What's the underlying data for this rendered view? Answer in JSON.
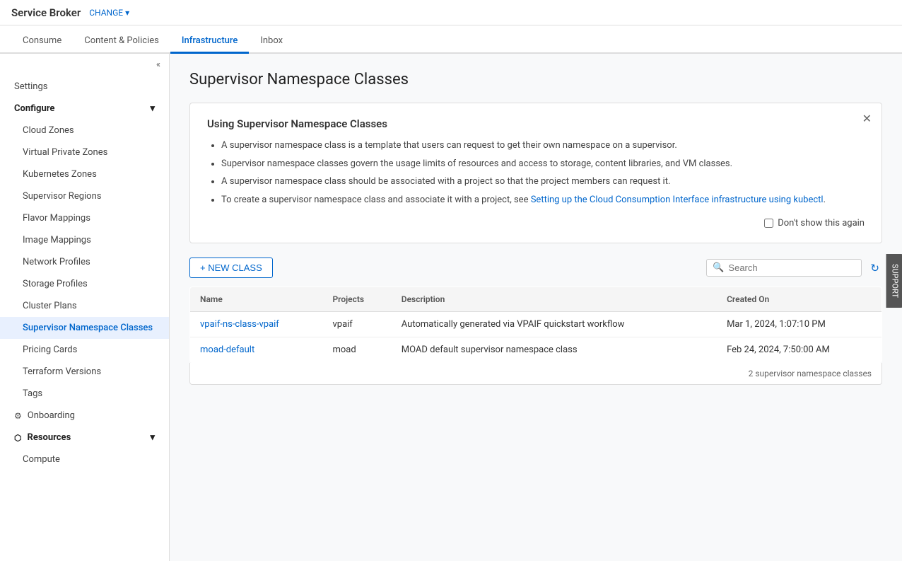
{
  "header": {
    "app_title": "Service Broker",
    "change_label": "CHANGE",
    "chevron": "▾"
  },
  "nav": {
    "tabs": [
      {
        "label": "Consume",
        "active": false
      },
      {
        "label": "Content & Policies",
        "active": false
      },
      {
        "label": "Infrastructure",
        "active": true
      },
      {
        "label": "Inbox",
        "active": false
      }
    ]
  },
  "sidebar": {
    "collapse_icon": "«",
    "items": [
      {
        "label": "Settings",
        "indent": false,
        "active": false,
        "section": false
      },
      {
        "label": "Configure",
        "indent": false,
        "active": false,
        "section": true
      },
      {
        "label": "Cloud Zones",
        "indent": true,
        "active": false,
        "section": false
      },
      {
        "label": "Virtual Private Zones",
        "indent": true,
        "active": false,
        "section": false
      },
      {
        "label": "Kubernetes Zones",
        "indent": true,
        "active": false,
        "section": false
      },
      {
        "label": "Supervisor Regions",
        "indent": true,
        "active": false,
        "section": false
      },
      {
        "label": "Flavor Mappings",
        "indent": true,
        "active": false,
        "section": false
      },
      {
        "label": "Image Mappings",
        "indent": true,
        "active": false,
        "section": false
      },
      {
        "label": "Network Profiles",
        "indent": true,
        "active": false,
        "section": false
      },
      {
        "label": "Storage Profiles",
        "indent": true,
        "active": false,
        "section": false
      },
      {
        "label": "Cluster Plans",
        "indent": true,
        "active": false,
        "section": false
      },
      {
        "label": "Supervisor Namespace Classes",
        "indent": true,
        "active": true,
        "section": false
      },
      {
        "label": "Pricing Cards",
        "indent": true,
        "active": false,
        "section": false
      },
      {
        "label": "Terraform Versions",
        "indent": true,
        "active": false,
        "section": false
      },
      {
        "label": "Tags",
        "indent": true,
        "active": false,
        "section": false
      },
      {
        "label": "Onboarding",
        "indent": false,
        "active": false,
        "section": false,
        "icon": "⚙"
      },
      {
        "label": "Resources",
        "indent": false,
        "active": false,
        "section": true
      },
      {
        "label": "Compute",
        "indent": true,
        "active": false,
        "section": false
      }
    ]
  },
  "main": {
    "page_title": "Supervisor Namespace Classes",
    "info_banner": {
      "title": "Using Supervisor Namespace Classes",
      "bullets": [
        "A supervisor namespace class is a template that users can request to get their own namespace on a supervisor.",
        "Supervisor namespace classes govern the usage limits of resources and access to storage, content libraries, and VM classes.",
        "A supervisor namespace class should be associated with a project so that the project members can request it.",
        "To create a supervisor namespace class and associate it with a project, see Setting up the Cloud Consumption Interface infrastructure using kubectl."
      ],
      "link_text": "Setting up the Cloud Consumption Interface infrastructure using kubectl",
      "checkbox_label": "Don't show this again"
    },
    "toolbar": {
      "new_class_label": "+ NEW CLASS",
      "search_placeholder": "Search"
    },
    "table": {
      "columns": [
        "Name",
        "Projects",
        "Description",
        "Created On"
      ],
      "rows": [
        {
          "name": "vpaif-ns-class-vpaif",
          "projects": "vpaif",
          "description": "Automatically generated via VPAIF quickstart workflow",
          "created_on": "Mar 1, 2024, 1:07:10 PM"
        },
        {
          "name": "moad-default",
          "projects": "moad",
          "description": "MOAD default supervisor namespace class",
          "created_on": "Feb 24, 2024, 7:50:00 AM"
        }
      ],
      "footer": "2 supervisor namespace classes"
    }
  },
  "support_tab": "SUPPORT"
}
